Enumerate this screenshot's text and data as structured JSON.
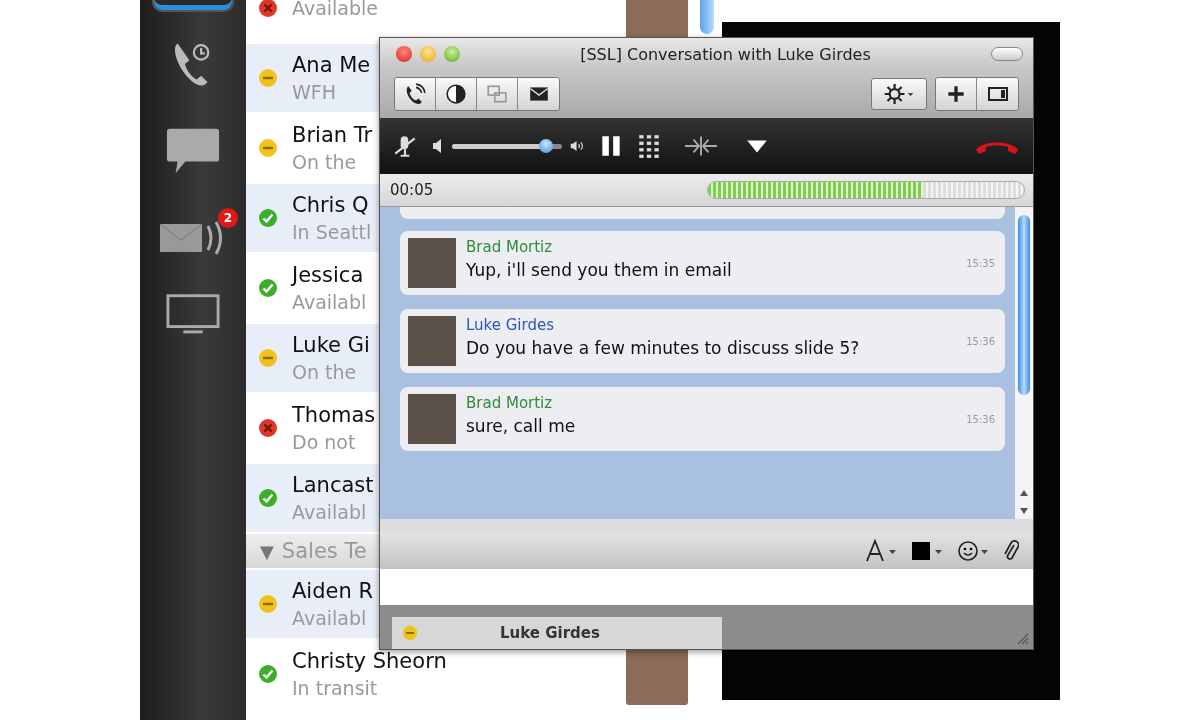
{
  "sidebar": {
    "voicemail_badge": "2"
  },
  "contacts": [
    {
      "status_text": "Available",
      "color": "#d93a2a",
      "photo": true
    },
    {
      "name": "Ana Me",
      "status_text": "WFH",
      "color": "#f1c21c",
      "photo": false
    },
    {
      "name": "Brian Tr",
      "status_text": "On the",
      "color": "#f1c21c",
      "photo": false
    },
    {
      "name": "Chris Q",
      "status_text": "In Seattl",
      "color": "#3cae2a",
      "photo": false
    },
    {
      "name": "Jessica",
      "status_text": "Availabl",
      "color": "#3cae2a",
      "photo": false
    },
    {
      "name": "Luke Gi",
      "status_text": "On the",
      "color": "#f1c21c",
      "photo": false
    },
    {
      "name": "Thomas",
      "status_text": "Do not",
      "color": "#d93a2a",
      "photo": false
    },
    {
      "name": "Lancast",
      "status_text": "Availabl",
      "color": "#3cae2a",
      "photo": false
    },
    {
      "kind": "group",
      "toggle": "▼",
      "name": "Sales Te"
    },
    {
      "name": "Aiden R",
      "status_text": "Availabl",
      "color": "#f1c21c",
      "photo": false
    },
    {
      "name": "Christy Sheorn",
      "status_text": "In transit",
      "color": "#3cae2a",
      "photo": true
    }
  ],
  "window": {
    "title": "[SSL] Conversation with Luke Girdes"
  },
  "call": {
    "volume": {
      "level": 0.85
    },
    "timer": "00:05",
    "audio_meter": {
      "level": 0.68
    }
  },
  "messages": [
    {
      "sender": "Brad Mortiz",
      "color": "#2e8b3a",
      "text": "Yup, i'll send you them in email",
      "time": "15:35"
    },
    {
      "sender": "Luke Girdes",
      "color": "#2f55b8",
      "text": "Do you have a few minutes to discuss slide 5?",
      "time": "15:36"
    },
    {
      "sender": "Brad Mortiz",
      "color": "#2e8b3a",
      "text": "sure, call me",
      "time": "15:36"
    }
  ],
  "tabs": [
    {
      "label": "Luke Girdes",
      "color": "#f1c21c",
      "selected": true
    }
  ]
}
